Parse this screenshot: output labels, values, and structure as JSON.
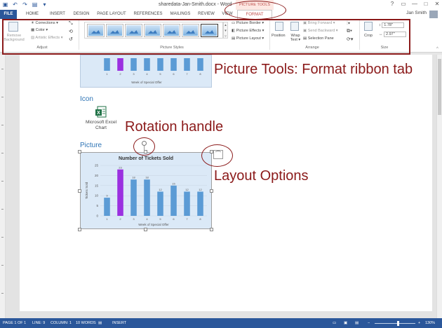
{
  "window": {
    "title": "sharedata-Jan-Smith.docx - Word",
    "context_header": "PICTURE TOOLS",
    "user": "Jan Smith",
    "controls": [
      "?",
      "▭",
      "—",
      "□",
      "✕"
    ]
  },
  "qat": [
    "save-icon",
    "undo-icon",
    "redo-icon",
    "print-icon",
    "customize-icon"
  ],
  "tabs": [
    "FILE",
    "HOME",
    "INSERT",
    "DESIGN",
    "PAGE LAYOUT",
    "REFERENCES",
    "MAILINGS",
    "REVIEW",
    "VIEW",
    "FORMAT"
  ],
  "ribbon": {
    "adjust": {
      "remove_background": "Remove Background",
      "corrections": "Corrections ▾",
      "color": "Color ▾",
      "artistic": "Artistic Effects ▾",
      "label": "Adjust"
    },
    "picture_styles": {
      "label": "Picture Styles",
      "border": "Picture Border ▾",
      "effects": "Picture Effects ▾",
      "layout": "Picture Layout ▾"
    },
    "arrange": {
      "position": "Position",
      "wrap": "Wrap Text ▾",
      "bring_forward": "Bring Forward ▾",
      "send_backward": "Send Backward ▾",
      "selection_pane": "Selection Pane",
      "label": "Arrange"
    },
    "size": {
      "crop": "Crop",
      "height": "1.78\"",
      "width": "2.97\"",
      "label": "Size"
    }
  },
  "document": {
    "icon_heading": "Icon",
    "excel_label_1": "Microsoft Excel",
    "excel_label_2": "Chart",
    "picture_heading": "Picture",
    "top_chart_xlabel": "Week of Special Offer"
  },
  "callouts": {
    "ribbon": "Picture Tools: Format ribbon tab",
    "rotation": "Rotation handle",
    "layout": "Layout Options"
  },
  "chart_data": {
    "type": "bar",
    "title": "Number of Tickets Sold",
    "xlabel": "Week of Special Offer",
    "ylabel": "Tickets Sold",
    "categories": [
      "1",
      "2",
      "3",
      "4",
      "5",
      "6",
      "7",
      "8"
    ],
    "values": [
      9,
      23,
      18,
      18,
      12,
      15,
      12,
      12
    ],
    "ylim": [
      0,
      25
    ],
    "yticks": [
      0,
      5,
      10,
      15,
      20,
      25
    ],
    "colors": {
      "bar": "#5b9bd5",
      "highlight": "#9b30e0",
      "background": "#dbe9f7"
    },
    "highlight_index": 1
  },
  "status": {
    "page": "PAGE 1 OF 1",
    "line": "LINE: 9",
    "column": "COLUMN: 1",
    "words": "10 WORDS",
    "mode": "INSERT",
    "zoom": "130%"
  }
}
